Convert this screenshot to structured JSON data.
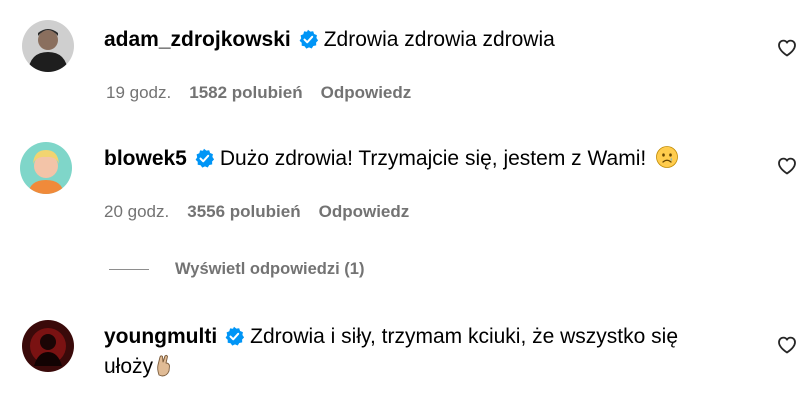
{
  "comments": [
    {
      "username": "adam_zdrojkowski",
      "text": "Zdrowia zdrowia zdrowia",
      "time": "19 godz.",
      "likes": "1582 polubień",
      "reply": "Odpowiedz",
      "verified": true,
      "avatar_icon": "user-photo-dark"
    },
    {
      "username": "blowek5",
      "text": "Dużo zdrowia! Trzymajcie się, jestem z Wami!",
      "text_emoji": "😢",
      "time": "20 godz.",
      "likes": "3556 polubień",
      "reply": "Odpowiedz",
      "verified": true,
      "avatar_icon": "user-photo-cartoon"
    },
    {
      "username": "youngmulti",
      "text": "Zdrowia i siły, trzymam kciuki, że wszystko się",
      "text_cont": "ułoży",
      "text_emoji": "🤞",
      "verified": true,
      "avatar_icon": "user-photo-red"
    }
  ],
  "view_replies": "Wyświetl odpowiedzi (1)",
  "colors": {
    "verified_badge": "#0095f6",
    "meta_text": "#737373",
    "text": "#000000"
  },
  "icons": [
    "verified-badge-icon",
    "heart-outline-icon",
    "crying-face-emoji",
    "crossed-fingers-emoji"
  ]
}
